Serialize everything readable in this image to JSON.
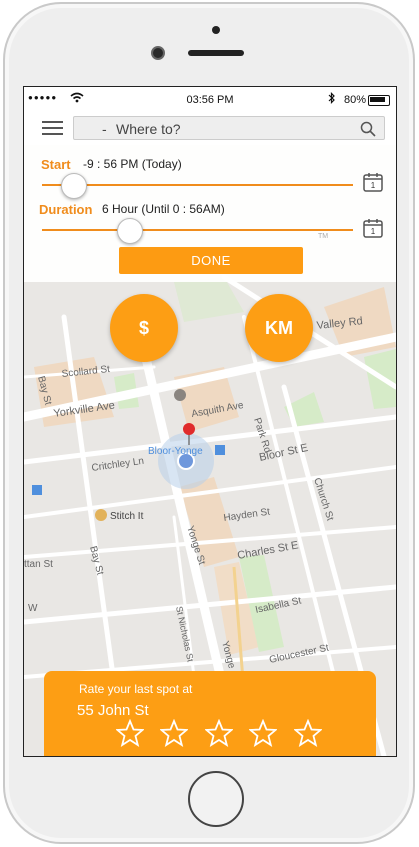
{
  "status_bar": {
    "signal": "●●●●●",
    "time": "03:56 PM",
    "battery": "80%"
  },
  "search": {
    "placeholder_prefix": "-",
    "placeholder": "Where to?"
  },
  "start": {
    "label": "Start",
    "value": "-9  : 56 PM (Today)",
    "slider_fraction": 0.1
  },
  "duration": {
    "label": "Duration",
    "value": "6 Hour (Until  0 : 56AM)",
    "slider_fraction": 0.28
  },
  "done_label": "DONE",
  "tm_mark": "TM",
  "map_buttons": {
    "price": "$",
    "distance": "KM"
  },
  "map_labels": {
    "scollard": "Scollard St",
    "yorkville": "Yorkville Ave",
    "critchley": "Critchley Ln",
    "asquith": "Asquith Ave",
    "bloor_station": "Bloor-Yonge",
    "bloor_st": "Bloor St E",
    "park_rd": "Park Rd",
    "church": "Church St",
    "stitch": "Stitch It",
    "hayden": "Hayden St",
    "charles": "Charles St E",
    "isabella": "Isabella St",
    "gloucester": "Gloucester St",
    "yonge": "Yonge St",
    "yonge2": "Yonge St",
    "st_nicholas": "St Nicholas St",
    "bay": "Bay St",
    "bay2": "Bay St",
    "valley": "Valley Rd",
    "tan": "ttan St",
    "w": "W"
  },
  "rating": {
    "prompt": "Rate your last spot at",
    "address": "55 John St",
    "stars": 0,
    "max_stars": 5
  },
  "colors": {
    "accent": "#fd9e14",
    "label_orange": "#f08c1c"
  }
}
